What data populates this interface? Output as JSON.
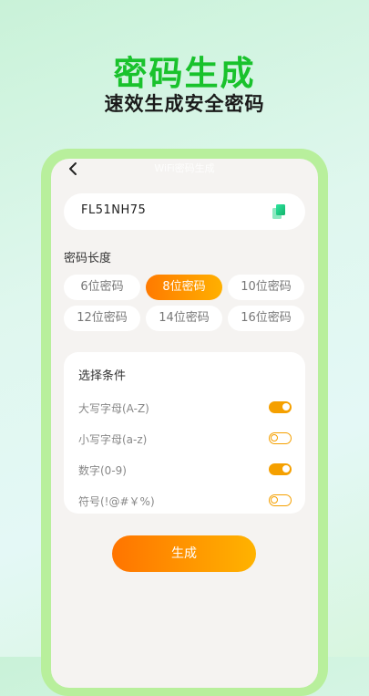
{
  "hero": {
    "title": "密码生成",
    "subtitle": "速效生成安全密码"
  },
  "screen": {
    "title": "WiFi密码生成"
  },
  "password": {
    "value": "FL51NH75",
    "copy_icon": "copy-icon"
  },
  "length": {
    "label": "密码长度",
    "selected": "8位密码",
    "options": [
      "6位密码",
      "8位密码",
      "10位密码",
      "12位密码",
      "14位密码",
      "16位密码"
    ]
  },
  "conditions": {
    "title": "选择条件",
    "items": [
      {
        "label": "大写字母(A-Z)",
        "enabled": true
      },
      {
        "label": "小写字母(a-z)",
        "enabled": false
      },
      {
        "label": "数字(0-9)",
        "enabled": true
      },
      {
        "label": "符号(!@#￥%)",
        "enabled": false
      }
    ]
  },
  "actions": {
    "generate_label": "生成"
  },
  "colors": {
    "brand_green": "#19c22c",
    "accent_orange": "#ff7a00",
    "accent_yellow": "#ffb000"
  }
}
